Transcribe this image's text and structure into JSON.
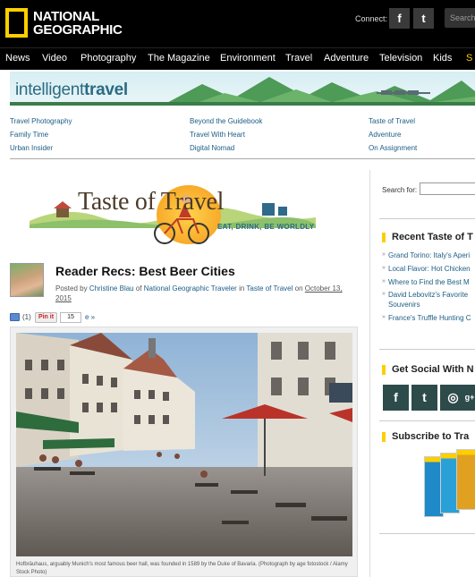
{
  "header": {
    "logo_text_1": "NATIONAL",
    "logo_text_2": "GEOGRAPHIC",
    "connect_label": "Connect:",
    "facebook_glyph": "f",
    "twitter_glyph": "t",
    "search_placeholder": "Search"
  },
  "nav": {
    "items": [
      "News",
      "Video",
      "Photography",
      "The Magazine",
      "Environment",
      "Travel",
      "Adventure",
      "Television",
      "Kids",
      "S"
    ]
  },
  "banner": {
    "title_light": "intelligent",
    "title_bold": "travel"
  },
  "links": {
    "col1": [
      "Travel Photography",
      "Family Time",
      "Urban Insider"
    ],
    "col2": [
      "Beyond the Guidebook",
      "Travel With Heart",
      "Digital Nomad"
    ],
    "col3": [
      "Taste of Travel",
      "Adventure",
      "On Assignment"
    ]
  },
  "section_logo": {
    "title": "Taste of Travel",
    "tagline": "EAT, DRINK, BE WORLDLY"
  },
  "article": {
    "title": "Reader Recs: Best Beer Cities",
    "posted_by": "Posted by",
    "author": "Christine Blau",
    "of": "of",
    "publication": "National Geographic Traveler",
    "in": "in",
    "category": "Taste of Travel",
    "on": "on",
    "date": "October 13, 2015",
    "comments": "(1)",
    "pinit": "Pin it",
    "pin_count": "15",
    "share_more": "e »",
    "caption": "Hofbräuhaus, arguably Munich's most famous beer hall, was founded in 1589 by the Duke of Bavaria. (Photograph by age fotostock / Alamy Stock Photo)"
  },
  "sidebar": {
    "search_label": "Search for:",
    "recent_heading": "Recent Taste of T",
    "recent_items": [
      "Grand Torino: Italy's Aperi",
      "Local Flavor: Hot Chicken",
      "Where to Find the Best M",
      "David Lebovitz's Favorite",
      "Souvenirs",
      "France's Truffle Hunting C"
    ],
    "social_heading": "Get Social With N",
    "social_icons": [
      "facebook-icon",
      "twitter-icon",
      "instagram-icon",
      "googleplus-icon"
    ],
    "social_glyphs": [
      "f",
      "t",
      "◎",
      "g+"
    ],
    "subscribe_heading": "Subscribe to Tra"
  },
  "colors": {
    "brand_yellow": "#ffce00",
    "link_blue": "#1c5d86",
    "header_black": "#000000"
  }
}
